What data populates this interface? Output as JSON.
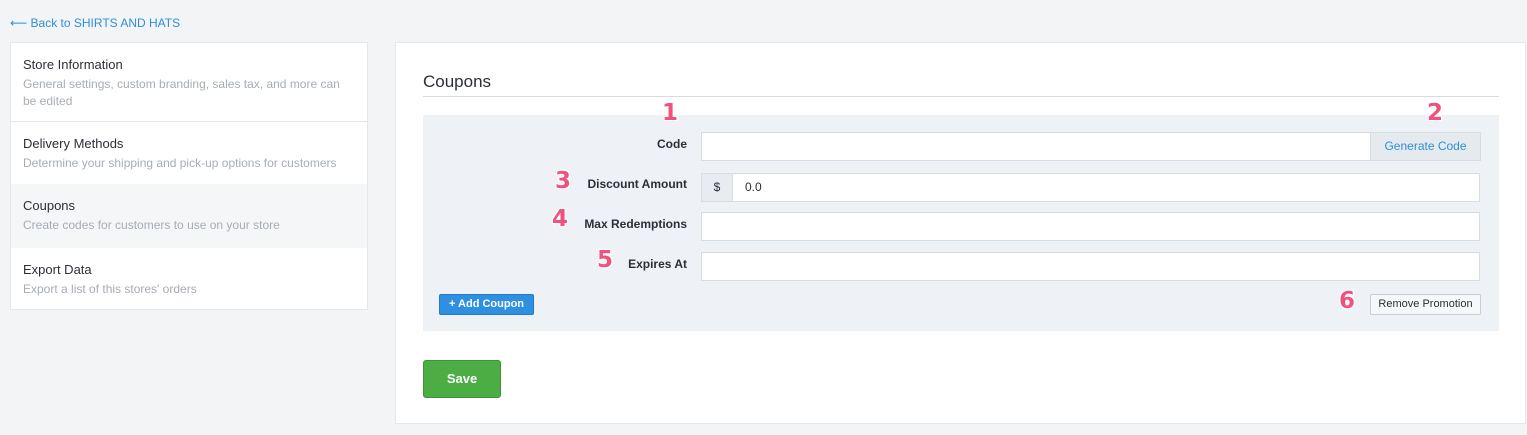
{
  "nav": {
    "back_link": "⟵ Back to SHIRTS AND HATS"
  },
  "sidebar": {
    "items": [
      {
        "title": "Store Information",
        "desc": "General settings, custom branding, sales tax, and more can be edited"
      },
      {
        "title": "Delivery Methods",
        "desc": "Determine your shipping and pick-up options for customers"
      },
      {
        "title": "Coupons",
        "desc": "Create codes for customers to use on your store",
        "active": true
      },
      {
        "title": "Export Data",
        "desc": "Export a list of this stores' orders"
      }
    ]
  },
  "main": {
    "title": "Coupons",
    "form": {
      "code": {
        "label": "Code",
        "value": "",
        "generate_label": "Generate Code"
      },
      "discount": {
        "label": "Discount Amount",
        "prefix": "$",
        "value": "0.0"
      },
      "max_redemptions": {
        "label": "Max Redemptions",
        "value": ""
      },
      "expires_at": {
        "label": "Expires At",
        "value": ""
      },
      "add_coupon_label": "+  Add Coupon",
      "remove_label": "Remove Promotion"
    },
    "save_label": "Save"
  },
  "badges": [
    "1",
    "2",
    "3",
    "4",
    "5",
    "6"
  ],
  "colors": {
    "accent": "#2f8fd8",
    "save": "#4cad45",
    "badge": "#f0527e"
  }
}
